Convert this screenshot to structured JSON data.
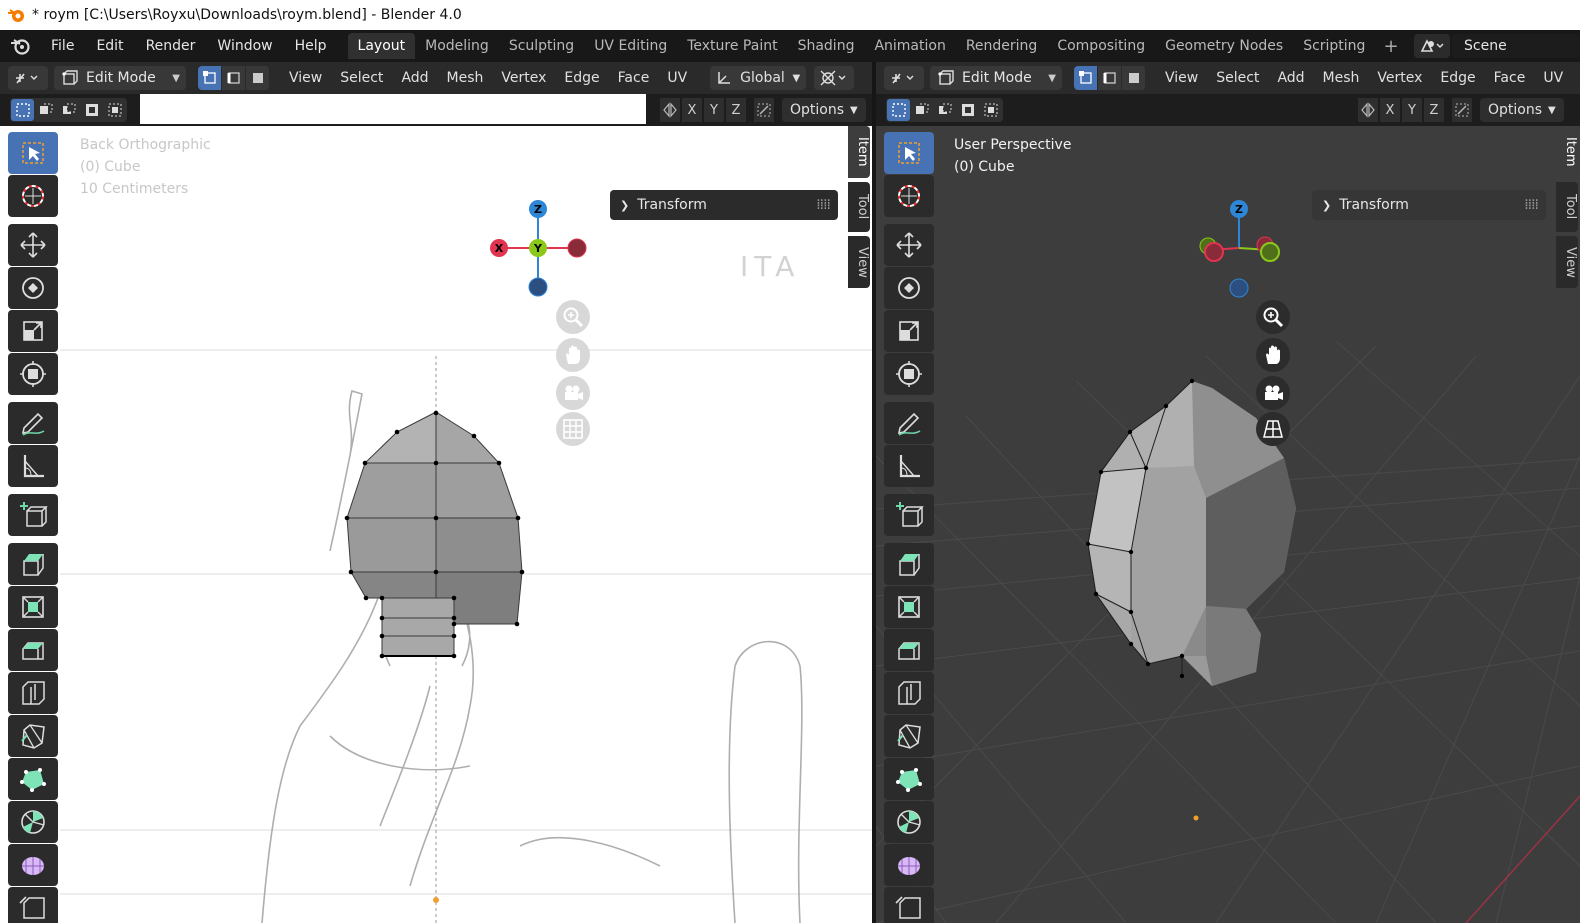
{
  "window": {
    "title": "* roym [C:\\Users\\Royxu\\Downloads\\roym.blend] - Blender 4.0"
  },
  "menubar": {
    "items": [
      "File",
      "Edit",
      "Render",
      "Window",
      "Help"
    ],
    "workspaces": [
      "Layout",
      "Modeling",
      "Sculpting",
      "UV Editing",
      "Texture Paint",
      "Shading",
      "Animation",
      "Rendering",
      "Compositing",
      "Geometry Nodes",
      "Scripting"
    ],
    "active_workspace": "Layout",
    "add_tab": "+",
    "scene": "Scene"
  },
  "left_view": {
    "mode": "Edit Mode",
    "menus": [
      "View",
      "Select",
      "Add",
      "Mesh",
      "Vertex",
      "Edge",
      "Face",
      "UV"
    ],
    "orientation": "Global",
    "axes": [
      "X",
      "Y",
      "Z"
    ],
    "options": "Options",
    "info": {
      "view_name": "Back Orthographic",
      "object": "(0) Cube",
      "scale": "10 Centimeters"
    },
    "panel_title": "Transform",
    "sidebar_tabs": [
      "Item",
      "Tool",
      "View"
    ],
    "gizmo": {
      "z": "Z",
      "x": "X",
      "y": "Y"
    },
    "reference_text": "ITA"
  },
  "right_view": {
    "mode": "Edit Mode",
    "menus": [
      "View",
      "Select",
      "Add",
      "Mesh",
      "Vertex",
      "Edge",
      "Face",
      "UV"
    ],
    "axes": [
      "X",
      "Y",
      "Z"
    ],
    "options": "Options",
    "info": {
      "view_name": "User Perspective",
      "object": "(0) Cube"
    },
    "panel_title": "Transform",
    "sidebar_tabs": [
      "Item",
      "Tool",
      "View"
    ],
    "gizmo": {
      "z": "Z"
    }
  },
  "colors": {
    "accent": "#4772b3",
    "axis_x": "#e0344f",
    "axis_y": "#8cc81a",
    "axis_z": "#2e86d6"
  }
}
